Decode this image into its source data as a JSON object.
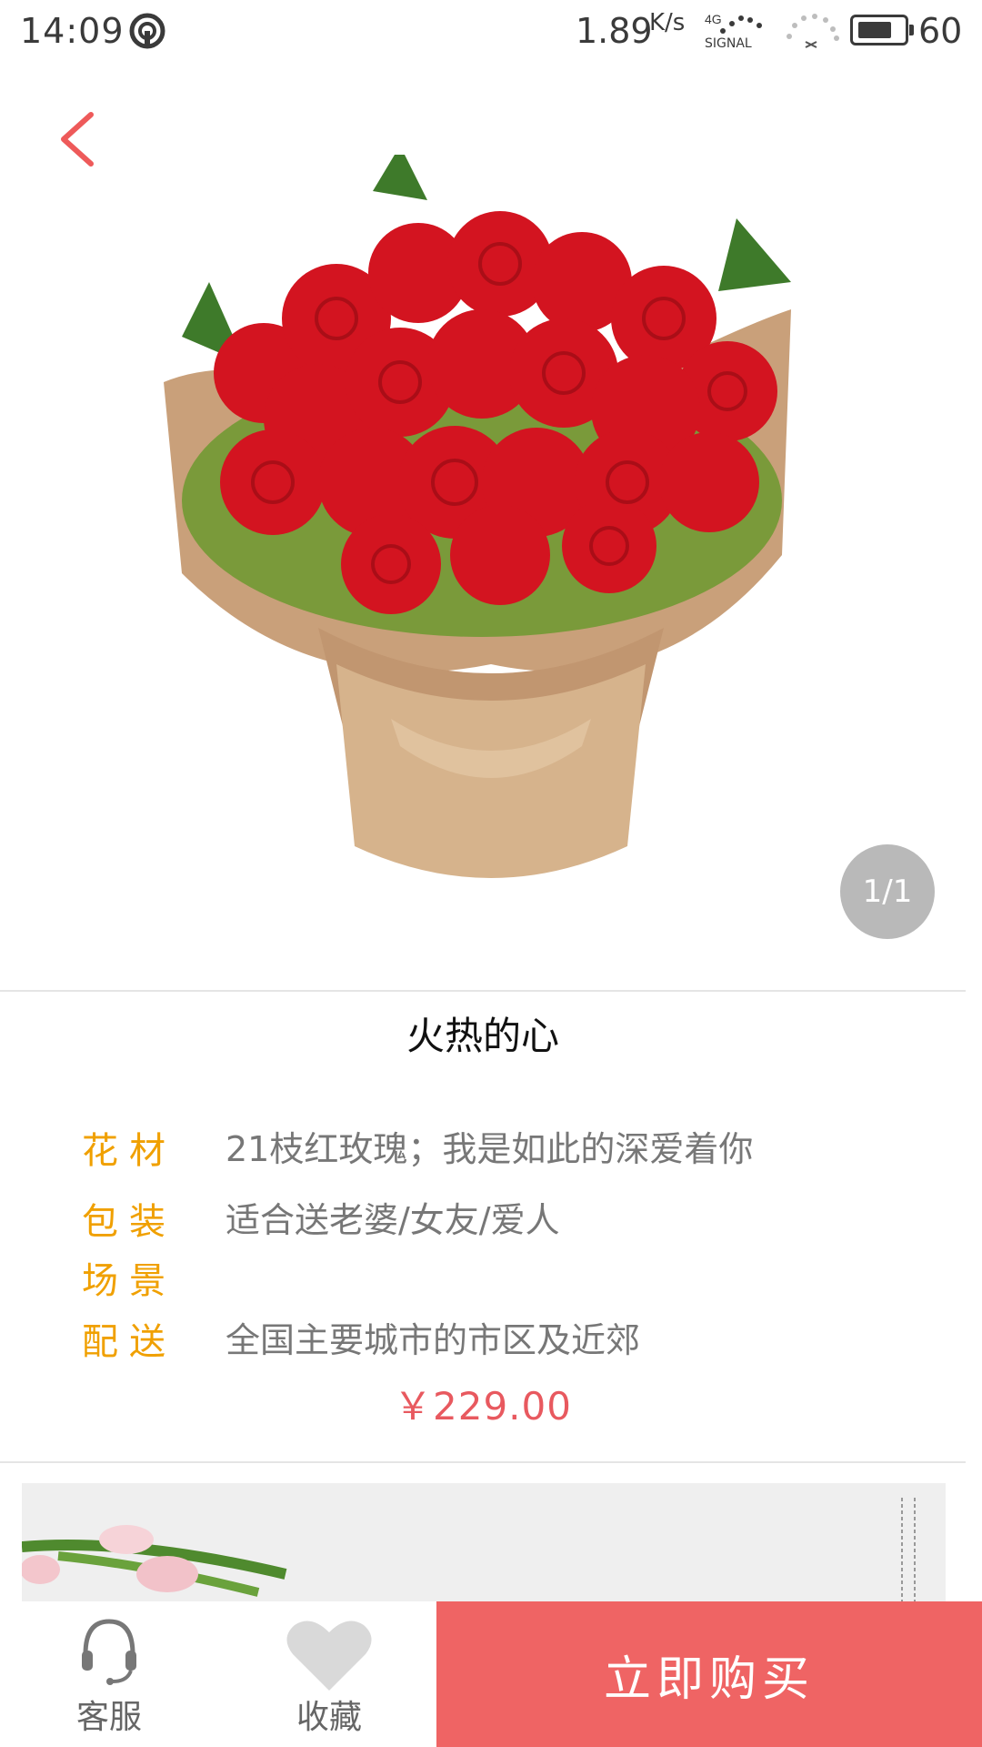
{
  "status_bar": {
    "time": "14:09",
    "net_speed": "1.89",
    "net_unit": "K/s",
    "signal_label": "SIGNAL",
    "network_type": "4G",
    "battery": "60"
  },
  "product": {
    "title": "火热的心",
    "image_counter": "1/1",
    "price": "￥229.00",
    "specs": [
      {
        "label": "花材",
        "value": "21枝红玫瑰；我是如此的深爱着你"
      },
      {
        "label": "包装",
        "value": "适合送老婆/女友/爱人"
      },
      {
        "label": "场景",
        "value": ""
      },
      {
        "label": "配送",
        "value": "全国主要城市的市区及近郊"
      }
    ]
  },
  "bottom_bar": {
    "service_label": "客服",
    "favorite_label": "收藏",
    "buy_label": "立即购买"
  },
  "colors": {
    "accent": "#ef6464",
    "price": "#e8595f",
    "label": "#f0a000",
    "back": "#ee5a5a"
  }
}
